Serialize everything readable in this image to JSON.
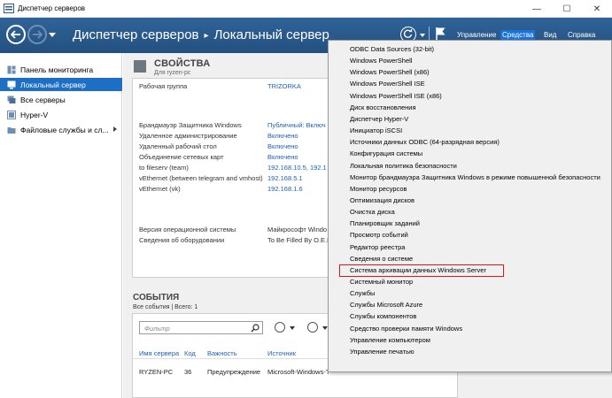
{
  "window": {
    "title": "Диспетчер серверов",
    "minimize": "—",
    "maximize": "☐",
    "close": "✕"
  },
  "header": {
    "breadcrumb_root": "Диспетчер серверов",
    "breadcrumb_current": "Локальный сервер",
    "menu": {
      "manage": "Управление",
      "tools": "Средства",
      "view": "Вид",
      "help": "Справка"
    }
  },
  "sidebar": {
    "items": [
      {
        "label": "Панель мониторинга",
        "active": false
      },
      {
        "label": "Локальный сервер",
        "active": true
      },
      {
        "label": "Все серверы",
        "active": false
      },
      {
        "label": "Hyper-V",
        "active": false
      },
      {
        "label": "Файловые службы и сл...",
        "active": false
      }
    ]
  },
  "properties": {
    "title": "СВОЙСТВА",
    "subtitle": "Для ryzen-pc",
    "rows": [
      {
        "key": "Рабочая группа",
        "value": "TRIZORKA",
        "link": true
      },
      {
        "key": "Брандмауэр Защитника Windows",
        "value": "Публичный: Включ",
        "link": true
      },
      {
        "key": "Удаленное администрирование",
        "value": "Включено",
        "link": true
      },
      {
        "key": "Удаленный рабочий стол",
        "value": "Включено",
        "link": true
      },
      {
        "key": "Объединение сетевых карт",
        "value": "Включено",
        "link": true
      },
      {
        "key": "to fileserv (team)",
        "value": "192.168.10.5, 192.1",
        "link": true
      },
      {
        "key": "vEthernet (between telegram and vmhost)",
        "value": "192.168.5.1",
        "link": true
      },
      {
        "key": "vEthernet (vk)",
        "value": "192.168.1.6",
        "link": true
      },
      {
        "key": "Версия операционной системы",
        "value": "Майкрософт Windo",
        "link": false
      },
      {
        "key": "Сведения об оборудовании",
        "value": "To Be Filled By O.E.M",
        "link": false
      }
    ]
  },
  "events": {
    "title": "СОБЫТИЯ",
    "summary": "Все события | Всего: 1",
    "filter_placeholder": "Фильтр",
    "columns": [
      "Имя сервера",
      "Код",
      "Важность",
      "Источник"
    ],
    "rows": [
      {
        "server": "RYZEN-PC",
        "code": "36",
        "severity": "Предупреждение",
        "source": "Microsoft-Windows-T"
      }
    ]
  },
  "tools_menu": {
    "items": [
      "ODBC Data Sources (32-bit)",
      "Windows PowerShell",
      "Windows PowerShell (x86)",
      "Windows PowerShell ISE",
      "Windows PowerShell ISE (x86)",
      "Диск восстановления",
      "Диспетчер Hyper-V",
      "Инициатор iSCSI",
      "Источники данных ODBC (64-разрядная версия)",
      "Конфигурация системы",
      "Локальная политика безопасности",
      "Монитор брандмауэра Защитника Windows в режиме повышенной безопасности",
      "Монитор ресурсов",
      "Оптимизация дисков",
      "Очистка диска",
      "Планировщик заданий",
      "Просмотр событий",
      "Редактор реестра",
      "Сведения о системе",
      "Система архивации данных Windows Server",
      "Системный монитор",
      "Службы",
      "Службы Microsoft Azure",
      "Службы компонентов",
      "Средство проверки памяти Windows",
      "Управление компьютером",
      "Управление печатью"
    ],
    "highlighted_index": 19,
    "highlight_color": "#e0141b"
  },
  "colors": {
    "header_bg": "#2a5a8c",
    "sidebar_active": "#1c6fc5",
    "link": "#1d5fb5",
    "tools_active": "#1a73d9"
  }
}
